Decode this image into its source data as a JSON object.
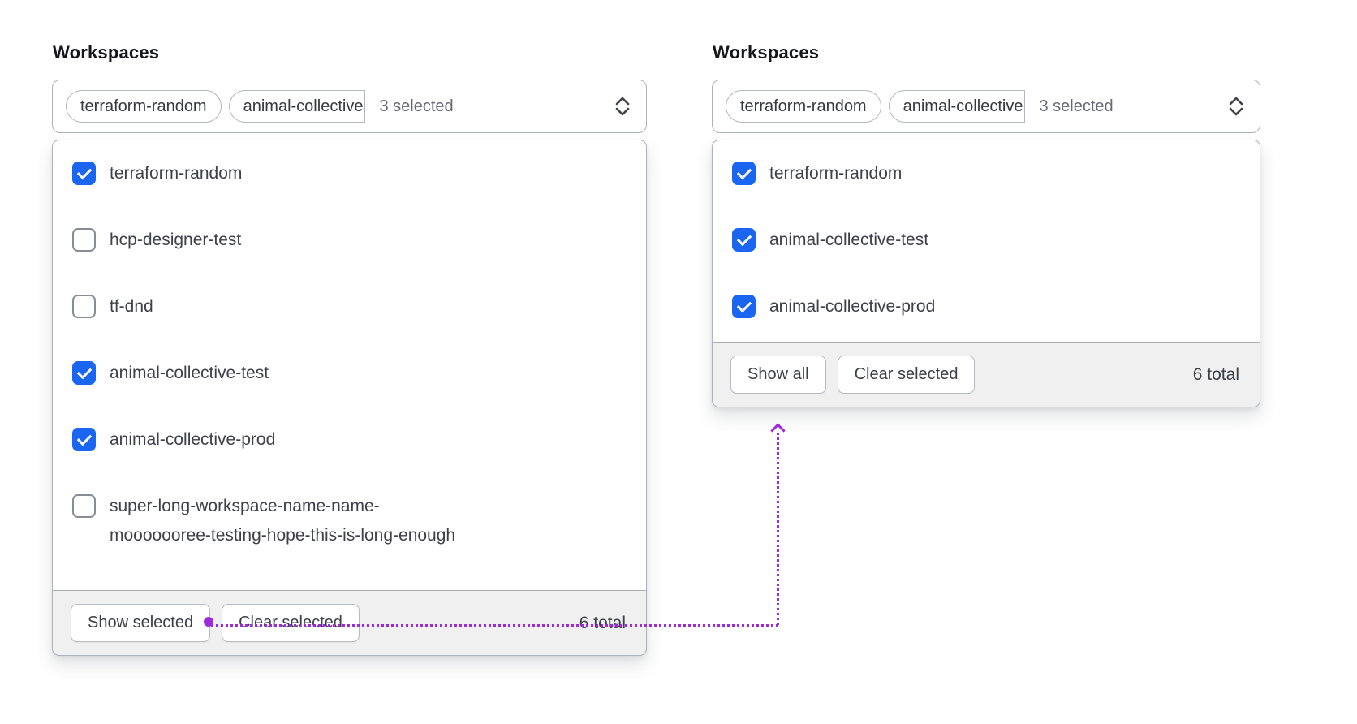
{
  "colors": {
    "checkbox_checked": "#1b66f0",
    "annotation_purple": "#9d2bdb"
  },
  "panels": [
    {
      "label": "Workspaces",
      "trigger": {
        "pills": [
          {
            "text": "terraform-random"
          },
          {
            "text": "animal-collective"
          }
        ],
        "count": "3 selected"
      },
      "items": [
        {
          "label": "terraform-random",
          "checked": "true"
        },
        {
          "label": "hcp-designer-test",
          "checked": "false"
        },
        {
          "label": "tf-dnd",
          "checked": "false"
        },
        {
          "label": "animal-collective-test",
          "checked": "true"
        },
        {
          "label": "animal-collective-prod",
          "checked": "true"
        },
        {
          "label": "super-long-workspace-name-name-\nmooooooree-testing-hope-this-is-long-enough",
          "checked": "false"
        }
      ],
      "footer": {
        "show_button": "Show selected",
        "clear_button": "Clear selected",
        "total": "6 total"
      }
    },
    {
      "label": "Workspaces",
      "trigger": {
        "pills": [
          {
            "text": "terraform-random"
          },
          {
            "text": "animal-collective"
          }
        ],
        "count": "3 selected"
      },
      "items": [
        {
          "label": "terraform-random",
          "checked": "true"
        },
        {
          "label": "animal-collective-test",
          "checked": "true"
        },
        {
          "label": "animal-collective-prod",
          "checked": "true"
        }
      ],
      "footer": {
        "show_button": "Show all",
        "clear_button": "Clear selected",
        "total": "6 total"
      }
    }
  ]
}
